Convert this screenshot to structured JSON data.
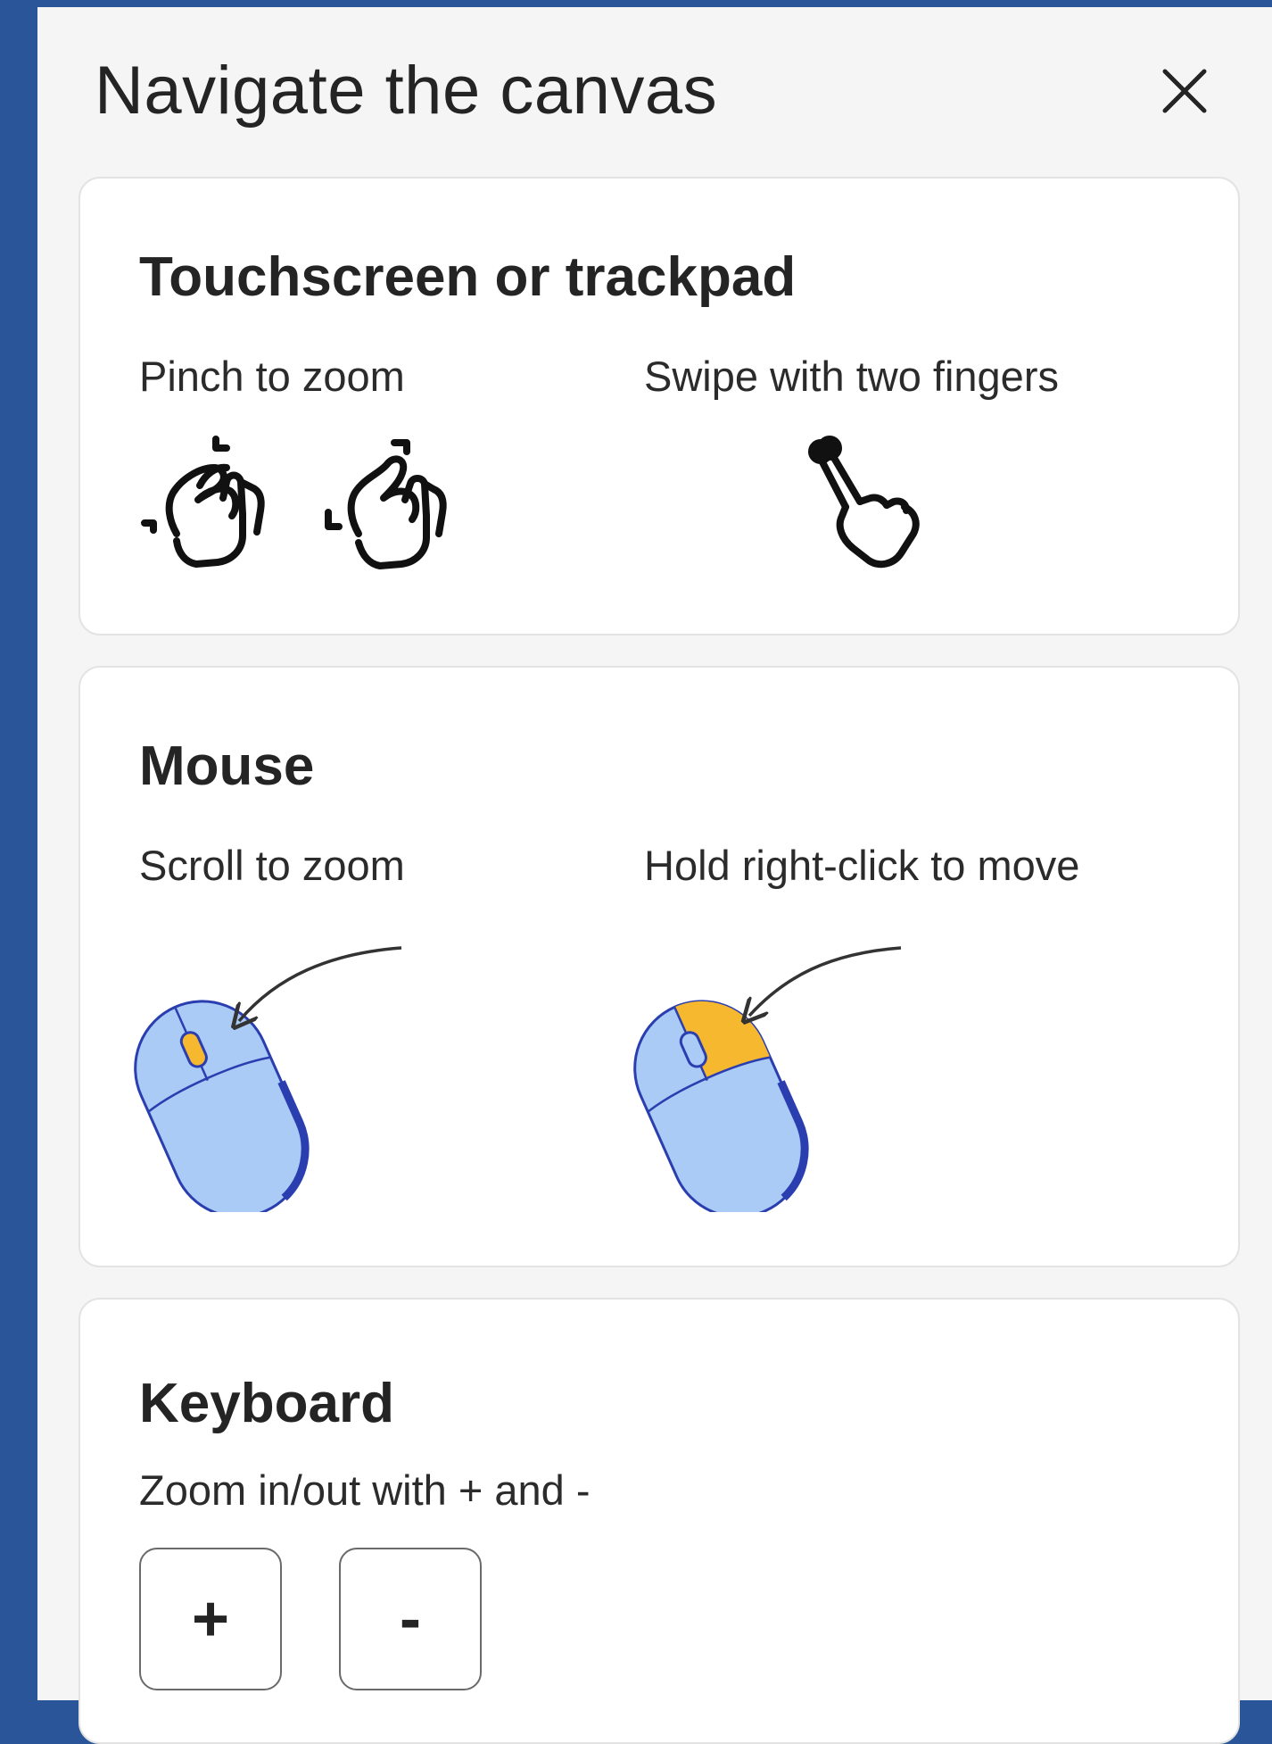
{
  "panel": {
    "title": "Navigate the canvas",
    "close_icon": "close-icon"
  },
  "touch": {
    "heading": "Touchscreen or trackpad",
    "pinch_label": "Pinch to zoom",
    "swipe_label": "Swipe with two fingers",
    "icons": [
      "pinch-out-hand-icon",
      "pinch-in-hand-icon",
      "two-finger-swipe-hand-icon"
    ]
  },
  "mouse": {
    "heading": "Mouse",
    "scroll_label": "Scroll to zoom",
    "hold_label": "Hold right-click to move",
    "icons": [
      "mouse-scroll-wheel-icon",
      "mouse-right-click-icon"
    ]
  },
  "keyboard": {
    "heading": "Keyboard",
    "zoom_label": "Zoom in/out with + and -",
    "plus_key": "+",
    "minus_key": "-"
  },
  "colors": {
    "background": "#2a5599",
    "panel": "#f5f5f5",
    "card": "#ffffff",
    "mouse_body": "#a9cbf6",
    "mouse_outline": "#2b3eb0",
    "highlight": "#f5b82e"
  }
}
